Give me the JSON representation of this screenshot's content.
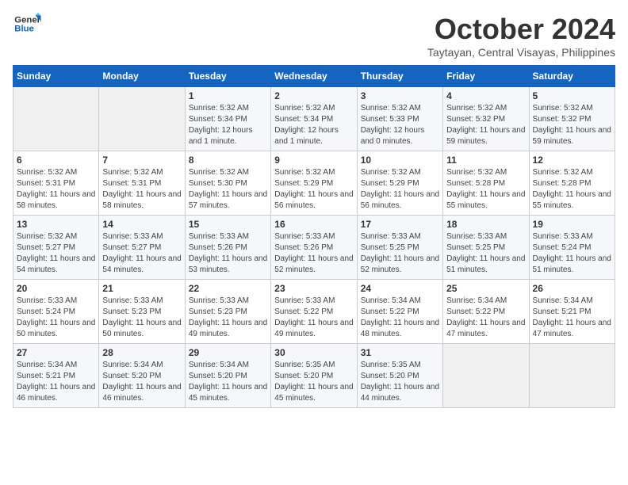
{
  "logo": {
    "line1": "General",
    "line2": "Blue"
  },
  "title": "October 2024",
  "subtitle": "Taytayan, Central Visayas, Philippines",
  "days_of_week": [
    "Sunday",
    "Monday",
    "Tuesday",
    "Wednesday",
    "Thursday",
    "Friday",
    "Saturday"
  ],
  "weeks": [
    [
      {
        "day": "",
        "info": ""
      },
      {
        "day": "",
        "info": ""
      },
      {
        "day": "1",
        "sunrise": "Sunrise: 5:32 AM",
        "sunset": "Sunset: 5:34 PM",
        "daylight": "Daylight: 12 hours and 1 minute."
      },
      {
        "day": "2",
        "sunrise": "Sunrise: 5:32 AM",
        "sunset": "Sunset: 5:34 PM",
        "daylight": "Daylight: 12 hours and 1 minute."
      },
      {
        "day": "3",
        "sunrise": "Sunrise: 5:32 AM",
        "sunset": "Sunset: 5:33 PM",
        "daylight": "Daylight: 12 hours and 0 minutes."
      },
      {
        "day": "4",
        "sunrise": "Sunrise: 5:32 AM",
        "sunset": "Sunset: 5:32 PM",
        "daylight": "Daylight: 11 hours and 59 minutes."
      },
      {
        "day": "5",
        "sunrise": "Sunrise: 5:32 AM",
        "sunset": "Sunset: 5:32 PM",
        "daylight": "Daylight: 11 hours and 59 minutes."
      }
    ],
    [
      {
        "day": "6",
        "sunrise": "Sunrise: 5:32 AM",
        "sunset": "Sunset: 5:31 PM",
        "daylight": "Daylight: 11 hours and 58 minutes."
      },
      {
        "day": "7",
        "sunrise": "Sunrise: 5:32 AM",
        "sunset": "Sunset: 5:31 PM",
        "daylight": "Daylight: 11 hours and 58 minutes."
      },
      {
        "day": "8",
        "sunrise": "Sunrise: 5:32 AM",
        "sunset": "Sunset: 5:30 PM",
        "daylight": "Daylight: 11 hours and 57 minutes."
      },
      {
        "day": "9",
        "sunrise": "Sunrise: 5:32 AM",
        "sunset": "Sunset: 5:29 PM",
        "daylight": "Daylight: 11 hours and 56 minutes."
      },
      {
        "day": "10",
        "sunrise": "Sunrise: 5:32 AM",
        "sunset": "Sunset: 5:29 PM",
        "daylight": "Daylight: 11 hours and 56 minutes."
      },
      {
        "day": "11",
        "sunrise": "Sunrise: 5:32 AM",
        "sunset": "Sunset: 5:28 PM",
        "daylight": "Daylight: 11 hours and 55 minutes."
      },
      {
        "day": "12",
        "sunrise": "Sunrise: 5:32 AM",
        "sunset": "Sunset: 5:28 PM",
        "daylight": "Daylight: 11 hours and 55 minutes."
      }
    ],
    [
      {
        "day": "13",
        "sunrise": "Sunrise: 5:32 AM",
        "sunset": "Sunset: 5:27 PM",
        "daylight": "Daylight: 11 hours and 54 minutes."
      },
      {
        "day": "14",
        "sunrise": "Sunrise: 5:33 AM",
        "sunset": "Sunset: 5:27 PM",
        "daylight": "Daylight: 11 hours and 54 minutes."
      },
      {
        "day": "15",
        "sunrise": "Sunrise: 5:33 AM",
        "sunset": "Sunset: 5:26 PM",
        "daylight": "Daylight: 11 hours and 53 minutes."
      },
      {
        "day": "16",
        "sunrise": "Sunrise: 5:33 AM",
        "sunset": "Sunset: 5:26 PM",
        "daylight": "Daylight: 11 hours and 52 minutes."
      },
      {
        "day": "17",
        "sunrise": "Sunrise: 5:33 AM",
        "sunset": "Sunset: 5:25 PM",
        "daylight": "Daylight: 11 hours and 52 minutes."
      },
      {
        "day": "18",
        "sunrise": "Sunrise: 5:33 AM",
        "sunset": "Sunset: 5:25 PM",
        "daylight": "Daylight: 11 hours and 51 minutes."
      },
      {
        "day": "19",
        "sunrise": "Sunrise: 5:33 AM",
        "sunset": "Sunset: 5:24 PM",
        "daylight": "Daylight: 11 hours and 51 minutes."
      }
    ],
    [
      {
        "day": "20",
        "sunrise": "Sunrise: 5:33 AM",
        "sunset": "Sunset: 5:24 PM",
        "daylight": "Daylight: 11 hours and 50 minutes."
      },
      {
        "day": "21",
        "sunrise": "Sunrise: 5:33 AM",
        "sunset": "Sunset: 5:23 PM",
        "daylight": "Daylight: 11 hours and 50 minutes."
      },
      {
        "day": "22",
        "sunrise": "Sunrise: 5:33 AM",
        "sunset": "Sunset: 5:23 PM",
        "daylight": "Daylight: 11 hours and 49 minutes."
      },
      {
        "day": "23",
        "sunrise": "Sunrise: 5:33 AM",
        "sunset": "Sunset: 5:22 PM",
        "daylight": "Daylight: 11 hours and 49 minutes."
      },
      {
        "day": "24",
        "sunrise": "Sunrise: 5:34 AM",
        "sunset": "Sunset: 5:22 PM",
        "daylight": "Daylight: 11 hours and 48 minutes."
      },
      {
        "day": "25",
        "sunrise": "Sunrise: 5:34 AM",
        "sunset": "Sunset: 5:22 PM",
        "daylight": "Daylight: 11 hours and 47 minutes."
      },
      {
        "day": "26",
        "sunrise": "Sunrise: 5:34 AM",
        "sunset": "Sunset: 5:21 PM",
        "daylight": "Daylight: 11 hours and 47 minutes."
      }
    ],
    [
      {
        "day": "27",
        "sunrise": "Sunrise: 5:34 AM",
        "sunset": "Sunset: 5:21 PM",
        "daylight": "Daylight: 11 hours and 46 minutes."
      },
      {
        "day": "28",
        "sunrise": "Sunrise: 5:34 AM",
        "sunset": "Sunset: 5:20 PM",
        "daylight": "Daylight: 11 hours and 46 minutes."
      },
      {
        "day": "29",
        "sunrise": "Sunrise: 5:34 AM",
        "sunset": "Sunset: 5:20 PM",
        "daylight": "Daylight: 11 hours and 45 minutes."
      },
      {
        "day": "30",
        "sunrise": "Sunrise: 5:35 AM",
        "sunset": "Sunset: 5:20 PM",
        "daylight": "Daylight: 11 hours and 45 minutes."
      },
      {
        "day": "31",
        "sunrise": "Sunrise: 5:35 AM",
        "sunset": "Sunset: 5:20 PM",
        "daylight": "Daylight: 11 hours and 44 minutes."
      },
      {
        "day": "",
        "info": ""
      },
      {
        "day": "",
        "info": ""
      }
    ]
  ]
}
